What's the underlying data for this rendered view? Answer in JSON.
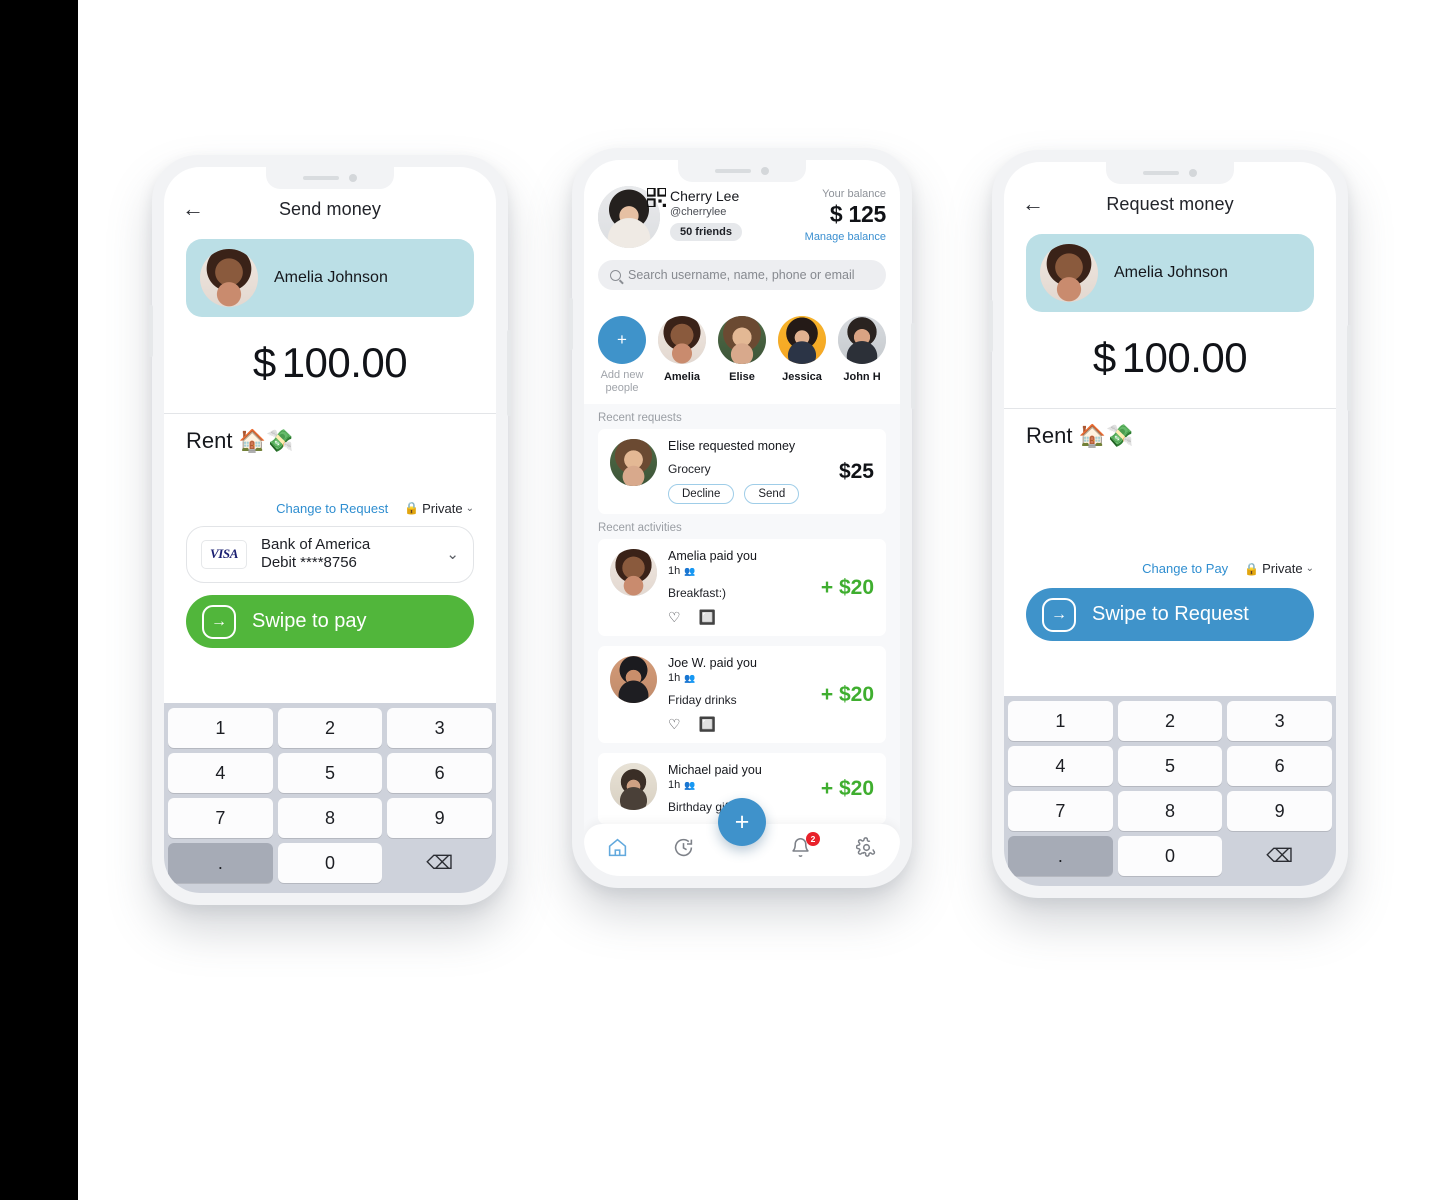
{
  "phones": {
    "send": {
      "title": "Send money",
      "back_icon": "arrow-left-icon",
      "recipient": {
        "name": "Amelia Johnson",
        "avatar": "amelia-avatar"
      },
      "amount": {
        "currency": "$",
        "value": "100.00"
      },
      "note": "Rent 🏠💸",
      "switch_link": "Change to Request",
      "privacy": {
        "label": "Private",
        "lock_icon": "lock-icon",
        "chevron": "⌄"
      },
      "payment_method": {
        "brand": "VISA",
        "line1": "Bank of America",
        "line2": "Debit ****8756",
        "chevron": "⌄"
      },
      "swipe": {
        "label": "Swipe to pay",
        "color": "#51b63b",
        "icon": "arrow-right-in-box-icon"
      },
      "keypad": [
        "1",
        "2",
        "3",
        "4",
        "5",
        "6",
        "7",
        "8",
        "9",
        ".",
        "0",
        "⌫"
      ]
    },
    "feed": {
      "account": {
        "name": "Cherry Lee",
        "handle": "@cherrylee",
        "friends": "50 friends",
        "qr_icon": "qr-code-icon",
        "avatar": "cherry-avatar"
      },
      "balance": {
        "label": "Your balance",
        "currency": "$",
        "value": "125",
        "link": "Manage balance"
      },
      "search": {
        "placeholder": "Search username, name, phone or email",
        "icon": "search-icon"
      },
      "people": [
        {
          "label": "Add new\npeople",
          "type": "add",
          "icon": "plus-icon"
        },
        {
          "label": "Amelia",
          "type": "person",
          "avatar": "amelia-avatar"
        },
        {
          "label": "Elise",
          "type": "person",
          "avatar": "elise-avatar"
        },
        {
          "label": "Jessica",
          "type": "person",
          "avatar": "jessica-avatar"
        },
        {
          "label": "John H",
          "type": "person",
          "avatar": "john-avatar"
        }
      ],
      "requests_label": "Recent requests",
      "requests": [
        {
          "title": "Elise requested money",
          "subtitle": "Grocery",
          "amount": "$25",
          "avatar": "elise-avatar",
          "decline_label": "Decline",
          "send_label": "Send"
        }
      ],
      "activities_label": "Recent activities",
      "activities": [
        {
          "title": "Amelia paid you",
          "time": "1h",
          "note": "Breakfast:)",
          "amount": "+ $20",
          "avatar": "amelia-avatar"
        },
        {
          "title": "Joe W. paid you",
          "time": "1h",
          "note": "Friday drinks",
          "amount": "+ $20",
          "avatar": "joe-avatar"
        },
        {
          "title": "Michael paid you",
          "time": "1h",
          "note": "Birthday gift",
          "amount": "+ $20",
          "avatar": "michael-avatar"
        }
      ],
      "nav": [
        {
          "icon": "home-icon",
          "glyph": "⌂",
          "active": true
        },
        {
          "icon": "history-clock-icon",
          "glyph": "◷",
          "active": false
        },
        {
          "icon": "bell-icon",
          "glyph": "🔔",
          "active": false,
          "badge": "2"
        },
        {
          "icon": "gear-icon",
          "glyph": "⚙",
          "active": false
        }
      ],
      "fab": {
        "icon": "plus-icon",
        "glyph": "+",
        "color": "#3f92cb"
      }
    },
    "request": {
      "title": "Request money",
      "back_icon": "arrow-left-icon",
      "recipient": {
        "name": "Amelia Johnson",
        "avatar": "amelia-avatar"
      },
      "amount": {
        "currency": "$",
        "value": "100.00"
      },
      "note": "Rent 🏠💸",
      "switch_link": "Change to Pay",
      "privacy": {
        "label": "Private",
        "lock_icon": "lock-icon",
        "chevron": "⌄"
      },
      "swipe": {
        "label": "Swipe to Request",
        "color": "#3f93ca",
        "icon": "arrow-right-in-box-icon"
      },
      "keypad": [
        "1",
        "2",
        "3",
        "4",
        "5",
        "6",
        "7",
        "8",
        "9",
        ".",
        "0",
        "⌫"
      ]
    }
  },
  "colors": {
    "recipient_card": "#bbdfe6",
    "pay_green": "#51b63b",
    "request_blue": "#3f93ca",
    "link_blue": "#2f8ed0",
    "amount_green": "#3fae2f",
    "badge_red": "#e8212a"
  }
}
